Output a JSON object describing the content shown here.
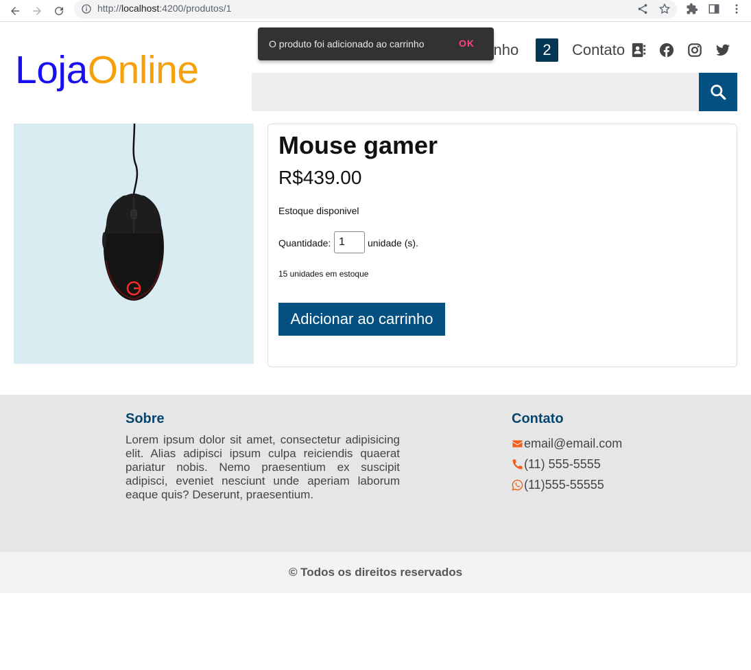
{
  "browser": {
    "url_scheme": "http://",
    "url_host": "localhost",
    "url_path": ":4200/produtos/1"
  },
  "header": {
    "logo_part1": "Loja",
    "logo_part2": "Online",
    "nav_cart_label": "rrinho",
    "cart_count": "2",
    "nav_contact_label": "Contato",
    "search": {
      "placeholder": ""
    }
  },
  "snackbar": {
    "message": "O produto foi adicionado ao carrinho",
    "action": "OK"
  },
  "product": {
    "title": "Mouse gamer",
    "price": "R$439.00",
    "stock_status": "Estoque disponivel",
    "quantity_label": "Quantidade:",
    "quantity_value": "1",
    "quantity_unit": "unidade (s).",
    "units_in_stock": "15 unidades em estoque",
    "add_button": "Adicionar ao carrinho"
  },
  "footer": {
    "about_title": "Sobre",
    "about_text": "Lorem ipsum dolor sit amet, consectetur adipisicing elit. Alias adipisci ipsum culpa reiciendis quaerat pariatur nobis. Nemo praesentium ex suscipit adipisci, eveniet nesciunt unde aperiam laborum eaque quis? Deserunt, praesentium.",
    "contact_title": "Contato",
    "email": "email@email.com",
    "phone": "(11) 555-5555",
    "whatsapp": "(11)555-55555",
    "copyright": "© Todos os direitos reservados"
  },
  "colors": {
    "brand_blue": "#1a0ff0",
    "brand_orange": "#f6a10c",
    "primary": "#045081",
    "badge": "#033554",
    "snackbar_action": "#ff4081",
    "footer_icon": "#f25f1a"
  },
  "icons": {
    "back": "arrow-left-icon",
    "forward": "arrow-right-icon",
    "reload": "reload-icon",
    "info": "info-icon",
    "share": "share-icon",
    "bookmark": "star-icon",
    "extensions": "puzzle-icon",
    "side_panel": "side-panel-icon",
    "menu": "kebab-menu-icon",
    "contact": "address-book-icon",
    "facebook": "facebook-icon",
    "instagram": "instagram-icon",
    "twitter": "twitter-icon",
    "search": "search-icon",
    "email": "envelope-icon",
    "phone": "phone-icon",
    "whatsapp": "whatsapp-icon"
  }
}
